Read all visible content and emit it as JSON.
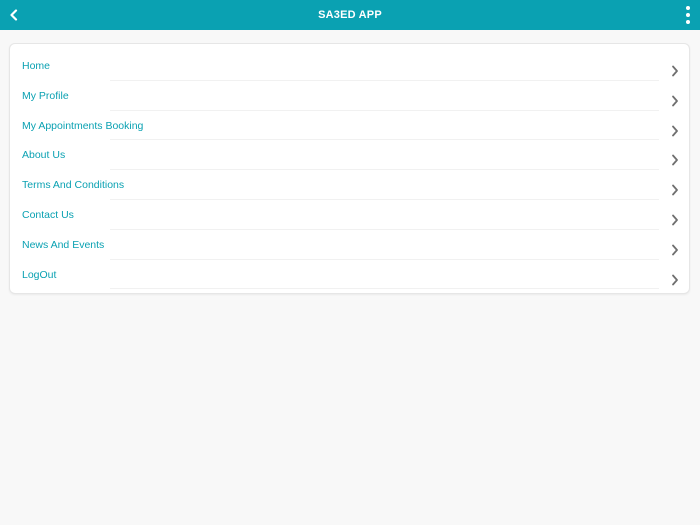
{
  "app": {
    "title": "SA3ED APP",
    "accent_color": "#0aa1b2",
    "back_icon": "chevron-left-icon",
    "overflow_icon": "more-vertical-icon"
  },
  "menu": {
    "items": [
      {
        "label": "Home",
        "icon": "chevron-right-icon"
      },
      {
        "label": "My Profile",
        "icon": "chevron-right-icon"
      },
      {
        "label": "My Appointments Booking",
        "icon": "chevron-right-icon"
      },
      {
        "label": "About Us",
        "icon": "chevron-right-icon"
      },
      {
        "label": "Terms And Conditions",
        "icon": "chevron-right-icon"
      },
      {
        "label": "Contact Us",
        "icon": "chevron-right-icon"
      },
      {
        "label": "News And Events",
        "icon": "chevron-right-icon"
      },
      {
        "label": "LogOut",
        "icon": "chevron-right-icon"
      }
    ]
  }
}
